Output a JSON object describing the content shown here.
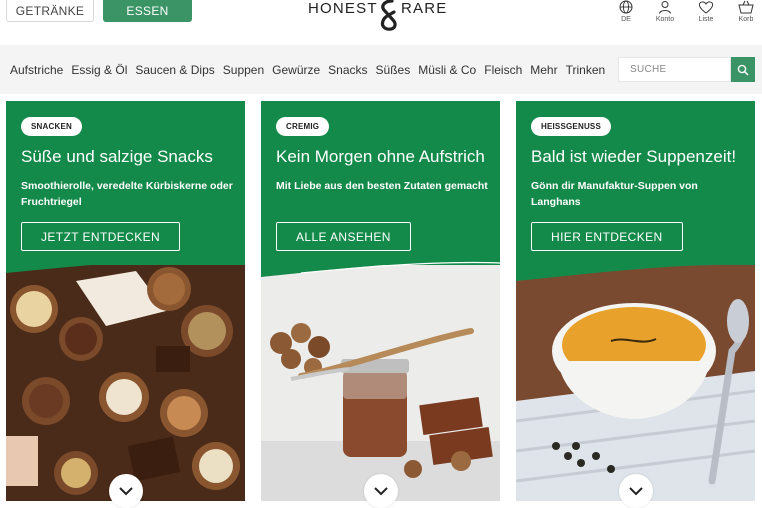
{
  "segments": {
    "drinks": "GETRÄNKE",
    "food": "ESSEN"
  },
  "logo": {
    "left": "HONEST",
    "right": "RARE"
  },
  "utility": [
    {
      "label": "DE",
      "icon": "globe-icon"
    },
    {
      "label": "Konto",
      "icon": "user-icon"
    },
    {
      "label": "Liste",
      "icon": "heart-icon"
    },
    {
      "label": "Korb",
      "icon": "basket-icon"
    }
  ],
  "nav": [
    "Aufstriche",
    "Essig & Öl",
    "Saucen & Dips",
    "Suppen",
    "Gewürze",
    "Snacks",
    "Süßes",
    "Müsli & Co",
    "Fleisch",
    "Mehr",
    "Trinken"
  ],
  "search": {
    "placeholder": "SUCHE",
    "icon": "search-icon"
  },
  "cards": [
    {
      "badge": "SNACKEN",
      "title": "Süße und salzige Snacks",
      "subtitle": "Smoothierolle, veredelte Kürbiskerne oder Fruchtriegel",
      "cta": "JETZT ENTDECKEN"
    },
    {
      "badge": "CREMIG",
      "title": "Kein Morgen ohne Aufstrich",
      "subtitle": "Mit Liebe aus den besten Zutaten gemacht",
      "cta": "ALLE ANSEHEN"
    },
    {
      "badge": "HEISSGENUSS",
      "title": "Bald ist wieder Suppenzeit!",
      "subtitle": "Gönn dir Manufaktur-Suppen von Langhans",
      "cta": "HIER ENTDECKEN"
    }
  ],
  "colors": {
    "brand_green": "#3a9466",
    "card_green": "#148a4a",
    "nav_bg": "#f4f4f4"
  }
}
